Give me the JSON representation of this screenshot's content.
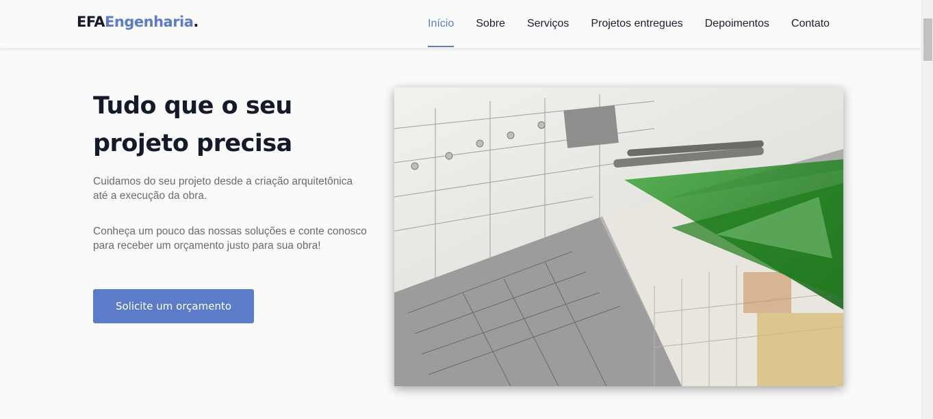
{
  "logo": {
    "part1": "EFA",
    "part2": "Engenharia",
    "part3": "."
  },
  "nav": {
    "items": [
      {
        "label": "Início",
        "active": true
      },
      {
        "label": "Sobre"
      },
      {
        "label": "Serviços"
      },
      {
        "label": "Projetos entregues"
      },
      {
        "label": "Depoimentos"
      },
      {
        "label": "Contato"
      }
    ]
  },
  "hero": {
    "title": "Tudo que o seu projeto precisa",
    "paragraph1": "Cuidamos do seu projeto desde a criação arquitetônica até a execução da obra.",
    "paragraph2": "Conheça um pouco das nossas soluções e conte conosco para receber um orçamento justo para sua obra!",
    "cta_label": "Solicite um orçamento"
  },
  "colors": {
    "accent": "#5c7cc9",
    "heading": "#151a2b",
    "text": "#6b6b6b",
    "background": "#fafafa"
  }
}
